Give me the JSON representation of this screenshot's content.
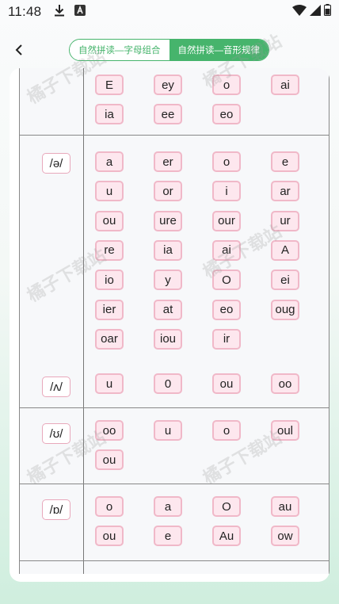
{
  "status_bar": {
    "time": "11:48"
  },
  "header": {
    "tabs": [
      {
        "label": "自然拼读—字母组合",
        "active": false
      },
      {
        "label": "自然拼读—音形规律",
        "active": true
      }
    ]
  },
  "watermark": "橘子下载站",
  "sections": [
    {
      "phonetic": "",
      "letters": [
        "E",
        "ey",
        "o",
        "ai",
        "ia",
        "ee",
        "eo"
      ]
    },
    {
      "phonetic": "/ə/",
      "letters": [
        "a",
        "er",
        "o",
        "e",
        "u",
        "or",
        "i",
        "ar",
        "ou",
        "ure",
        "our",
        "ur",
        "re",
        "ia",
        "ai",
        "A",
        "io",
        "y",
        "O",
        "ei",
        "ier",
        "at",
        "eo",
        "oug",
        "oar",
        "iou",
        "ir"
      ]
    },
    {
      "phonetic": "/ʌ/",
      "letters": [
        "u",
        "0",
        "ou",
        "oo"
      ]
    },
    {
      "phonetic": "/ʊ/",
      "letters": [
        "oo",
        "u",
        "o",
        "oul",
        "ou"
      ]
    },
    {
      "phonetic": "/ɒ/",
      "letters": [
        "o",
        "a",
        "O",
        "au",
        "ou",
        "e",
        "Au",
        "ow"
      ]
    }
  ],
  "colors": {
    "accent": "#46b46c",
    "tag_bg": "#fde7ee",
    "tag_border": "#f0b8c8"
  }
}
